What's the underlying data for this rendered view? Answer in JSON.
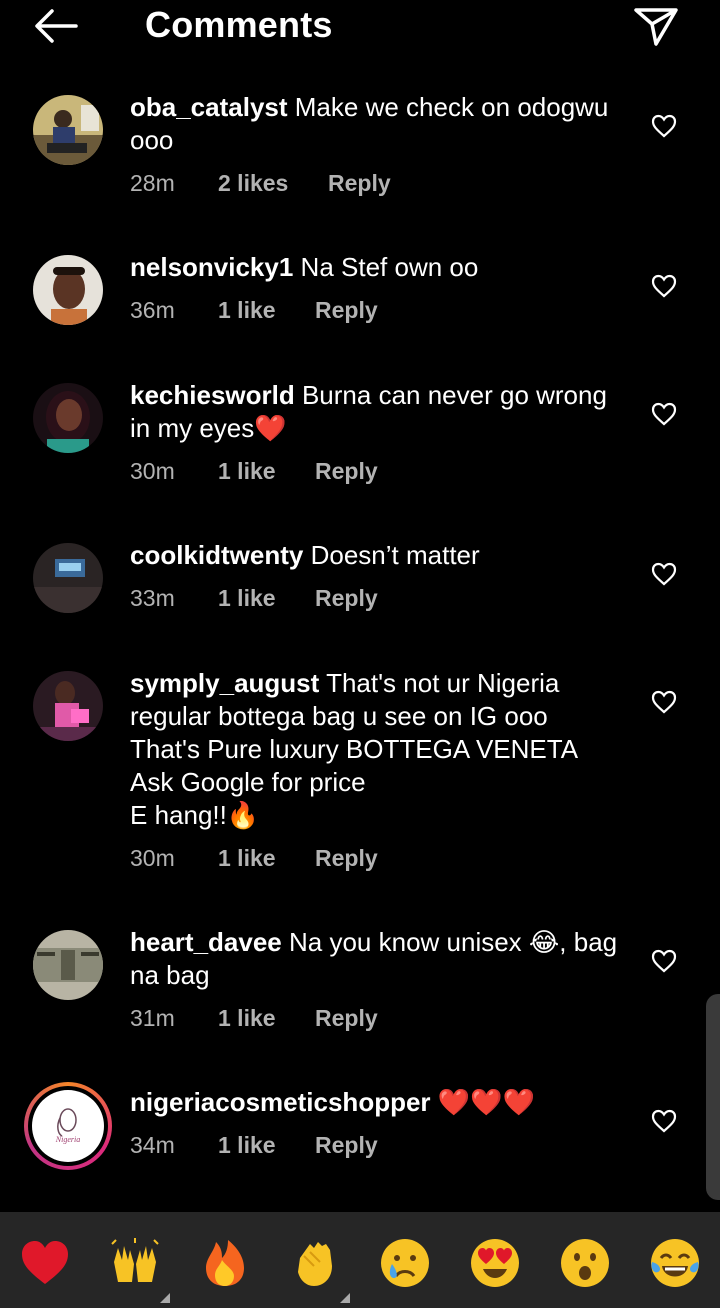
{
  "header": {
    "title": "Comments"
  },
  "comments": [
    {
      "username": "oba_catalyst",
      "text": "Make we check on odogwu ooo",
      "time": "28m",
      "likes": "2 likes",
      "reply": "Reply"
    },
    {
      "username": "nelsonvicky1",
      "text": "Na Stef own oo",
      "time": "36m",
      "likes": "1 like",
      "reply": "Reply"
    },
    {
      "username": "kechiesworld",
      "text": "Burna can never go wrong in my eyes❤️",
      "time": "30m",
      "likes": "1 like",
      "reply": "Reply"
    },
    {
      "username": "coolkidtwenty",
      "text": "Doesn’t matter",
      "time": "33m",
      "likes": "1 like",
      "reply": "Reply"
    },
    {
      "username": "symply_august",
      "text": "That's not ur Nigeria regular bottega bag u see on IG ooo",
      "text_line3": "That's Pure luxury BOTTEGA VENETA",
      "text_line4": "Ask Google for price",
      "text_line5": "E hang!!🔥",
      "time": "30m",
      "likes": "1 like",
      "reply": "Reply"
    },
    {
      "username": "heart_davee",
      "text": "Na you know unisex 😂, bag na bag",
      "time": "31m",
      "likes": "1 like",
      "reply": "Reply"
    },
    {
      "username": "nigeriacosmeticshopper",
      "text": "❤️❤️❤️",
      "time": "34m",
      "likes": "1 like",
      "reply": "Reply"
    }
  ],
  "emoji_bar": [
    {
      "name": "red-heart",
      "char": "❤️"
    },
    {
      "name": "raising-hands",
      "char": "🙌"
    },
    {
      "name": "fire",
      "char": "🔥"
    },
    {
      "name": "clapping-hands",
      "char": "👏"
    },
    {
      "name": "crying-face",
      "char": "😢"
    },
    {
      "name": "heart-eyes",
      "char": "😍"
    },
    {
      "name": "surprised-face",
      "char": "😮"
    },
    {
      "name": "tears-of-joy",
      "char": "😂"
    }
  ],
  "colors": {
    "background": "#000000",
    "secondary_text": "#b3b3b3",
    "emoji_bar": "#262626",
    "heart_red": "#e0182a",
    "story_ring": "#e1306c"
  }
}
